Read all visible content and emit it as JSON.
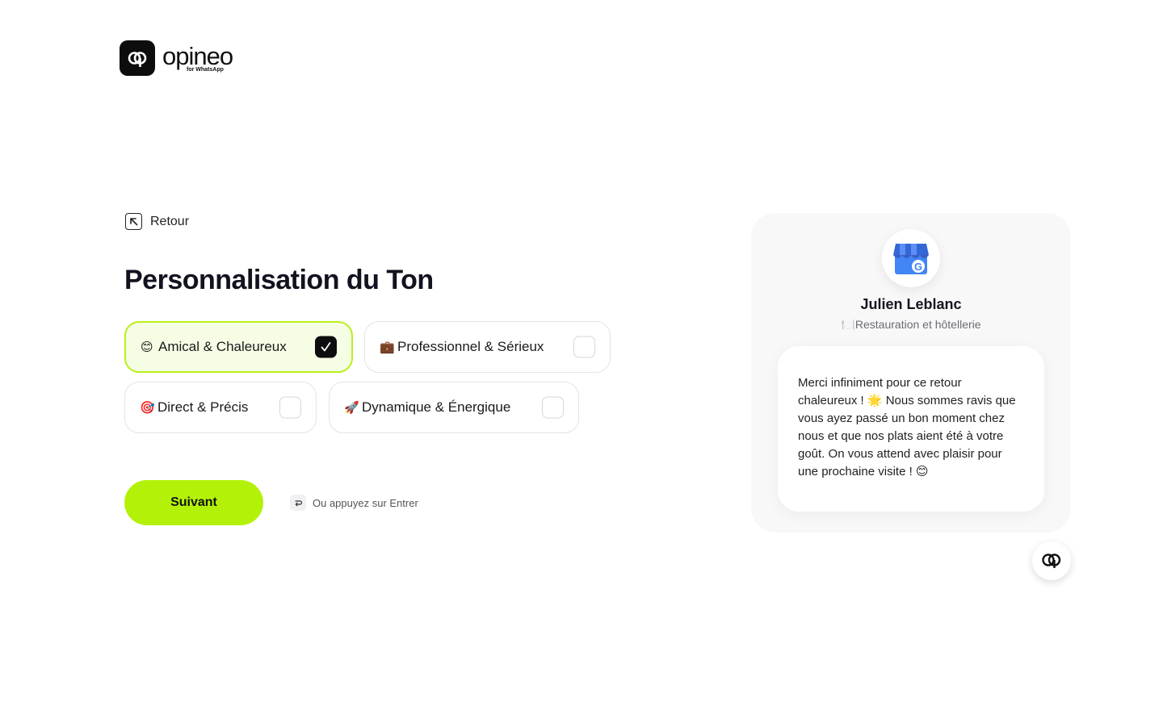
{
  "brand": {
    "name": "opineo",
    "tagline": "for WhatsApp"
  },
  "nav": {
    "back_label": "Retour"
  },
  "page": {
    "title": "Personnalisation du Ton"
  },
  "options": [
    {
      "emoji": "😊",
      "label": "Amical & Chaleureux",
      "checked": true
    },
    {
      "emoji": "💼",
      "label": "Professionnel & Sérieux",
      "checked": false
    },
    {
      "emoji": "🎯",
      "label": "Direct & Précis",
      "checked": false
    },
    {
      "emoji": "🚀",
      "label": "Dynamique & Énergique",
      "checked": false
    }
  ],
  "cta": {
    "label": "Suivant",
    "hint": "Ou appuyez sur Entrer"
  },
  "preview": {
    "name": "Julien Leblanc",
    "category_emoji": "🍽️",
    "category": "Restauration et hôtellerie",
    "message": "Merci infiniment pour ce retour chaleureux ! 🌟 Nous sommes ravis que vous ayez passé un bon moment chez nous et que nos plats aient été à votre goût. On vous attend avec plaisir pour une prochaine visite ! 😊"
  },
  "colors": {
    "accent": "#b3f208",
    "selected_bg": "#f5fde4",
    "selected_border": "#b9f11a",
    "dark": "#0d0d0d"
  },
  "icons": {
    "logo": "opineo-logo-icon",
    "back": "arrow-up-left-icon",
    "enter": "enter-key-icon",
    "business": "google-business-store-icon",
    "fab": "opineo-chat-icon"
  }
}
